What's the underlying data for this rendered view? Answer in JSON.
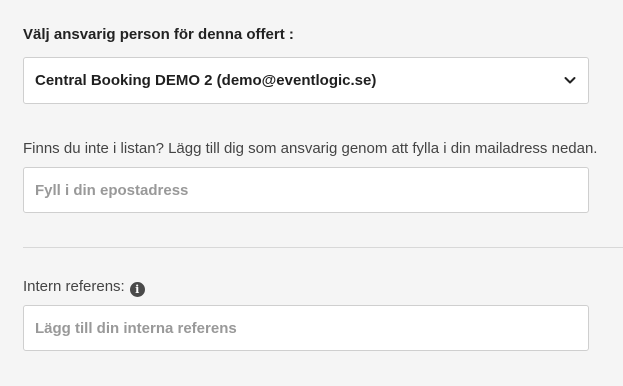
{
  "responsible": {
    "label": "Välj ansvarig person för denna offert :",
    "selected_value": "Central Booking DEMO 2 (demo@eventlogic.se)",
    "chevron_icon": "chevron-down-icon"
  },
  "not_listed": {
    "label": "Finns du inte i listan? Lägg till dig som ansvarig genom att fylla i din mailadress nedan.",
    "email_placeholder": "Fyll i din epostadress",
    "email_value": ""
  },
  "reference": {
    "label": "Intern referens:",
    "info_icon": "info-icon",
    "info_glyph": "i",
    "placeholder": "Lägg till din interna referens",
    "value": ""
  }
}
